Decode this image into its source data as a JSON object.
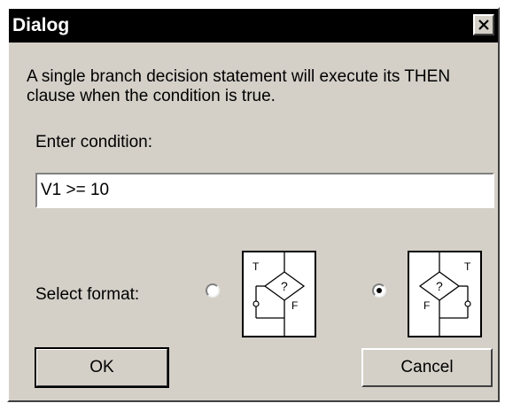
{
  "window": {
    "title": "Dialog",
    "close_icon": "close-icon"
  },
  "message": "A single branch decision statement will execute its THEN clause when the condition is true.",
  "condition": {
    "label": "Enter condition:",
    "value": "V1 >= 10"
  },
  "format": {
    "label": "Select format:",
    "options": [
      {
        "icon": "decision-true-left-icon",
        "selected": false,
        "true_label": "T",
        "false_label": "F",
        "question": "?"
      },
      {
        "icon": "decision-true-right-icon",
        "selected": true,
        "true_label": "T",
        "false_label": "F",
        "question": "?"
      }
    ]
  },
  "buttons": {
    "ok_label": "OK",
    "cancel_label": "Cancel"
  }
}
